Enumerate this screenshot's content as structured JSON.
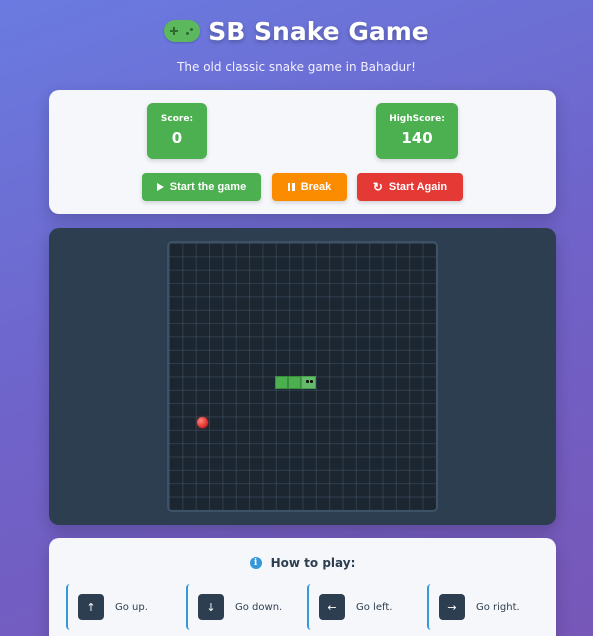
{
  "header": {
    "title": "SB Snake Game",
    "subtitle": "The old classic snake game in Bahadur!",
    "icon": "gamepad-icon"
  },
  "scoreboard": {
    "score_label": "Score:",
    "score_value": "0",
    "highscore_label": "HighScore:",
    "highscore_value": "140"
  },
  "buttons": {
    "start_label": "Start the game",
    "break_label": "Break",
    "restart_label": "Start Again"
  },
  "game": {
    "snake_segments": 3,
    "food_count": 1
  },
  "help": {
    "title": "How to play:",
    "controls": [
      {
        "key": "↑",
        "label": "Go up."
      },
      {
        "key": "↓",
        "label": "Go down."
      },
      {
        "key": "←",
        "label": "Go left."
      },
      {
        "key": "→",
        "label": "Go right."
      }
    ]
  },
  "colors": {
    "primary_green": "#4caf50",
    "orange": "#fb8c00",
    "red": "#e53935",
    "dark_panel": "#2c3e50",
    "info_blue": "#3498db"
  }
}
